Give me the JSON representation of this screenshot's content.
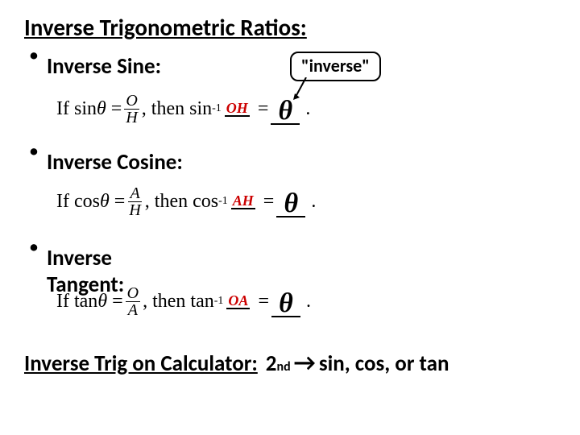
{
  "title": "Inverse Trigonometric Ratios:",
  "callout": "\"inverse\"",
  "sections": {
    "sine": {
      "label": "Inverse Sine:",
      "prefix": "If sin",
      "theta": "θ",
      "eq1": "=",
      "num1": "O",
      "den1": "H",
      "then": ", then sin",
      "sup": "-1",
      "rnum": "O",
      "rden": "H",
      "eq2": "=",
      "answer": "θ",
      "dot": "."
    },
    "cosine": {
      "label": "Inverse Cosine:",
      "prefix": "If cos",
      "theta": "θ",
      "eq1": "=",
      "num1": "A",
      "den1": "H",
      "then": ", then cos",
      "sup": "-1",
      "rnum": "A",
      "rden": "H",
      "eq2": "=",
      "answer": "θ",
      "dot": "."
    },
    "tangent": {
      "label": "Inverse Tangent:",
      "prefix": "If tan",
      "theta": "θ",
      "eq1": "=",
      "num1": "O",
      "den1": "A",
      "then": ", then tan",
      "sup": "-1",
      "rnum": "O",
      "rden": "A",
      "eq2": "=",
      "answer": "θ",
      "dot": "."
    }
  },
  "footer": {
    "label": "Inverse Trig on Calculator:",
    "second": "2",
    "nd": "nd",
    "rest": "sin, cos, or tan"
  }
}
